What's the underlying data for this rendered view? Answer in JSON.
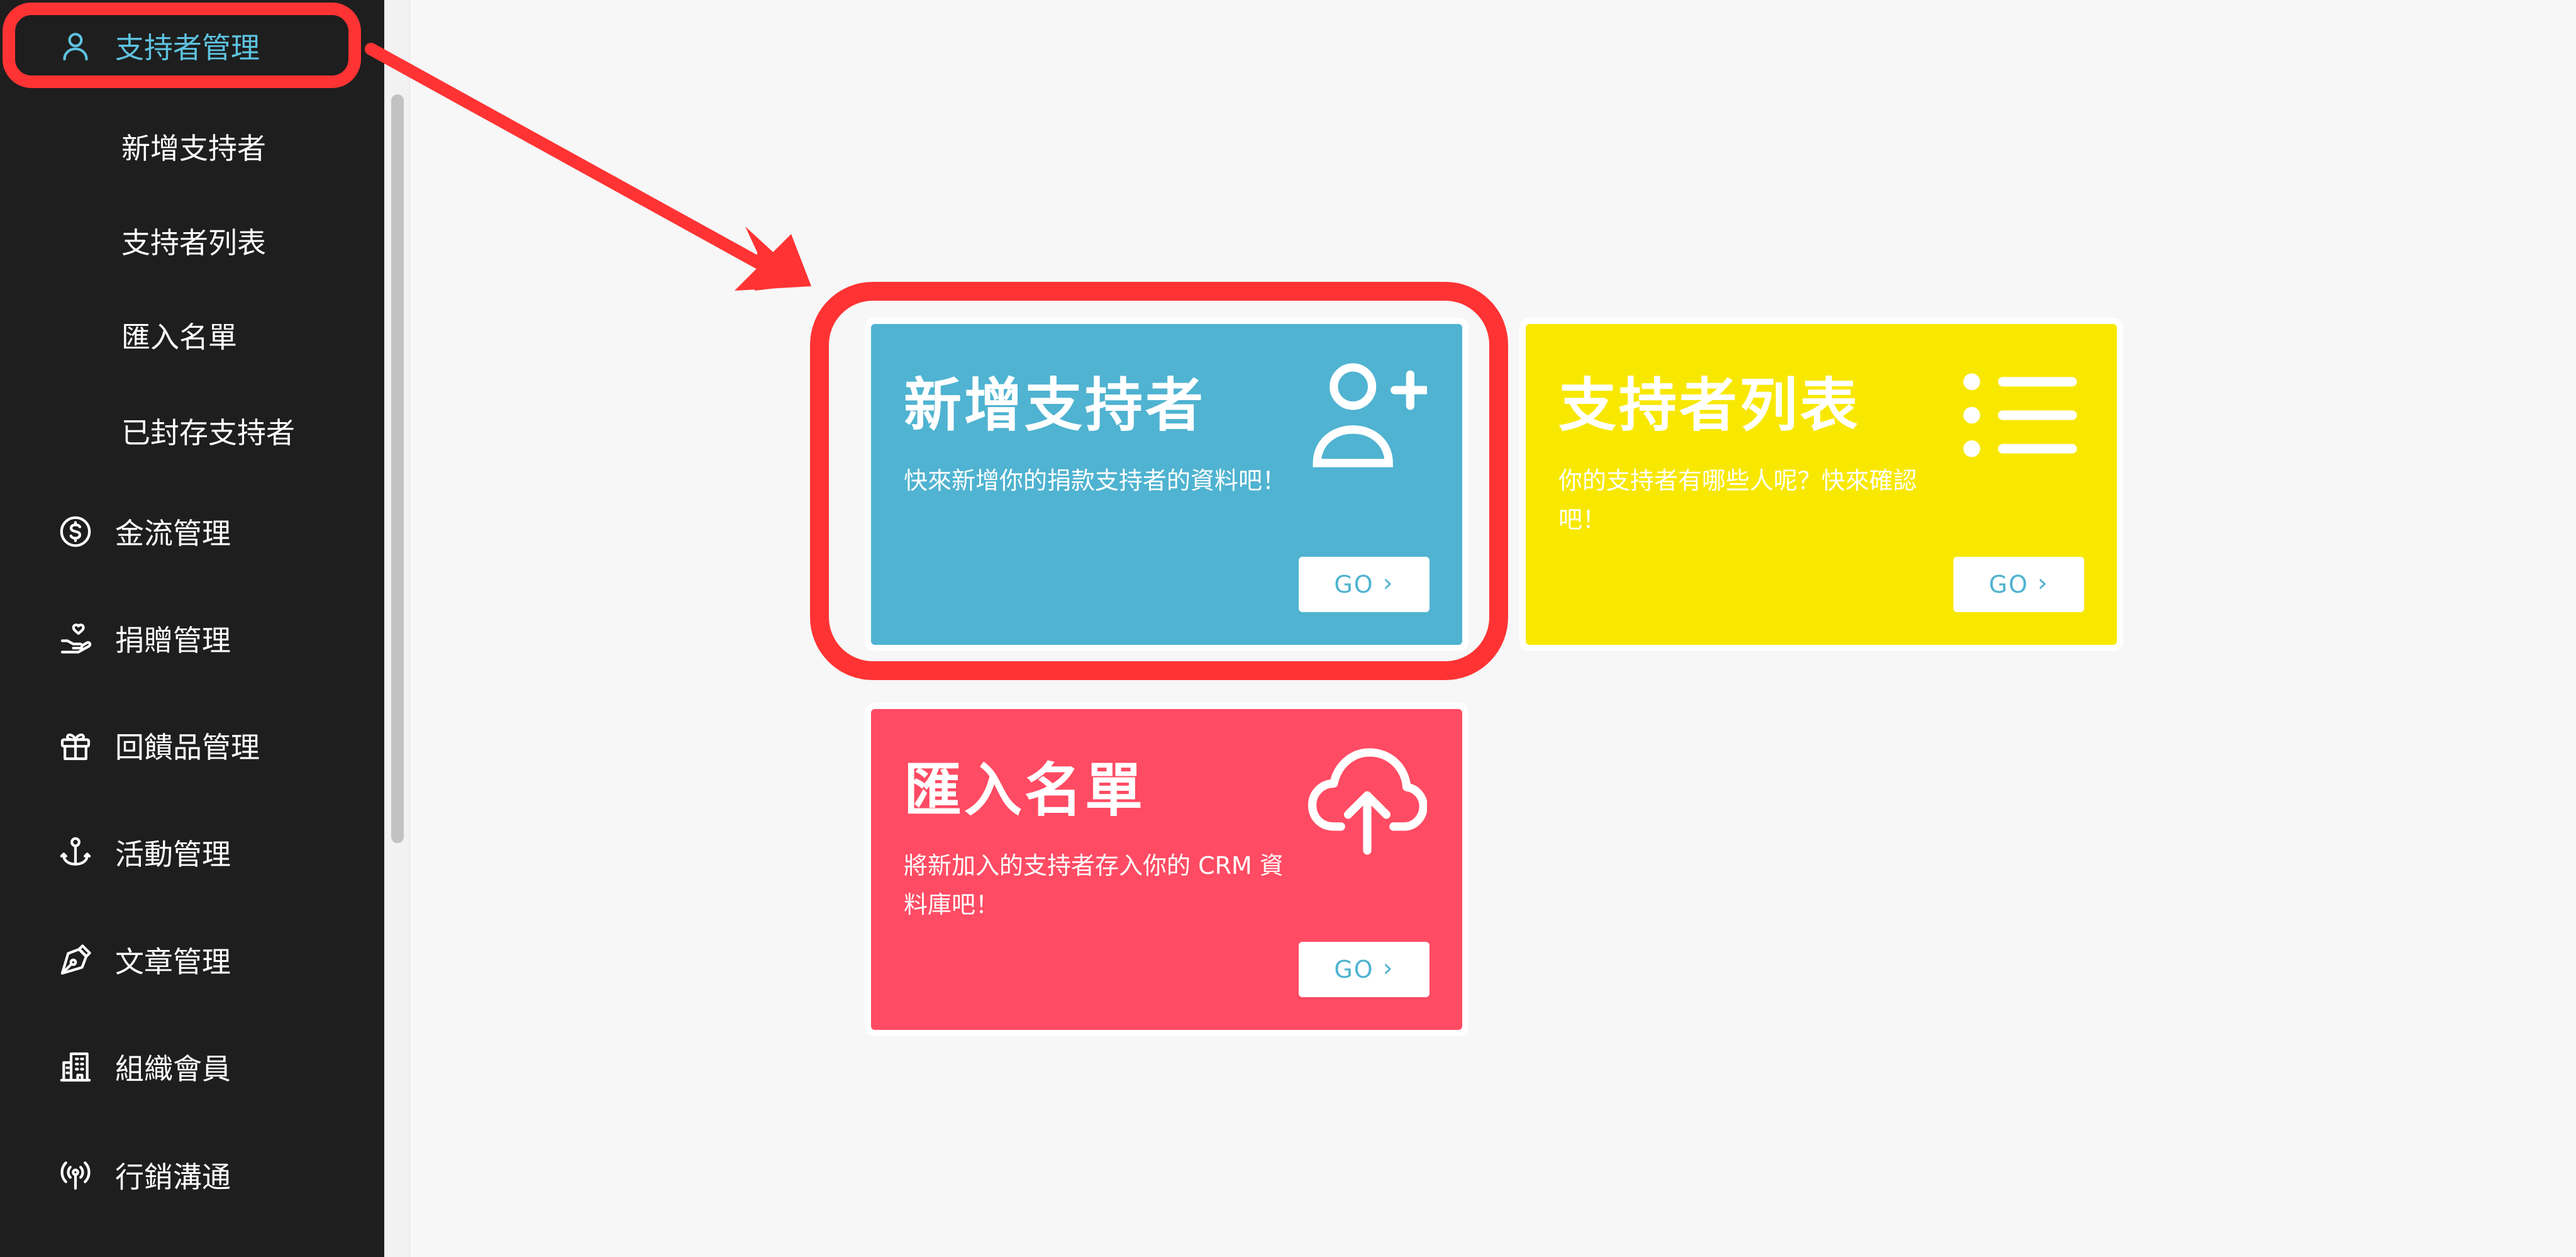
{
  "sidebar": {
    "items": [
      {
        "id": "supporter-management",
        "label": "支持者管理",
        "icon": "user-icon",
        "active": true
      },
      {
        "id": "finance-management",
        "label": "金流管理",
        "icon": "dollar-circle-icon"
      },
      {
        "id": "donation-management",
        "label": "捐贈管理",
        "icon": "hand-heart-icon"
      },
      {
        "id": "reward-management",
        "label": "回饋品管理",
        "icon": "gift-icon"
      },
      {
        "id": "event-management",
        "label": "活動管理",
        "icon": "anchor-icon"
      },
      {
        "id": "article-management",
        "label": "文章管理",
        "icon": "pen-icon"
      },
      {
        "id": "organization-members",
        "label": "組織會員",
        "icon": "building-icon"
      },
      {
        "id": "marketing-communication",
        "label": "行銷溝通",
        "icon": "broadcast-icon"
      }
    ],
    "subitems": [
      {
        "label": "新增支持者"
      },
      {
        "label": "支持者列表"
      },
      {
        "label": "匯入名單"
      },
      {
        "label": "已封存支持者"
      }
    ]
  },
  "cards": [
    {
      "title": "新增支持者",
      "desc": "快來新增你的捐款支持者的資料吧！",
      "button": "GO",
      "icon": "user-plus-icon",
      "color": "#4fb3d1"
    },
    {
      "title": "支持者列表",
      "desc": "你的支持者有哪些人呢？快來確認吧！",
      "button": "GO",
      "icon": "list-icon",
      "color": "#f8e800"
    },
    {
      "title": "匯入名單",
      "desc": "將新加入的支持者存入你的 CRM 資料庫吧！",
      "button": "GO",
      "icon": "cloud-upload-icon",
      "color": "#ff4b63"
    }
  ],
  "annotation": {
    "color": "#ff3333"
  }
}
